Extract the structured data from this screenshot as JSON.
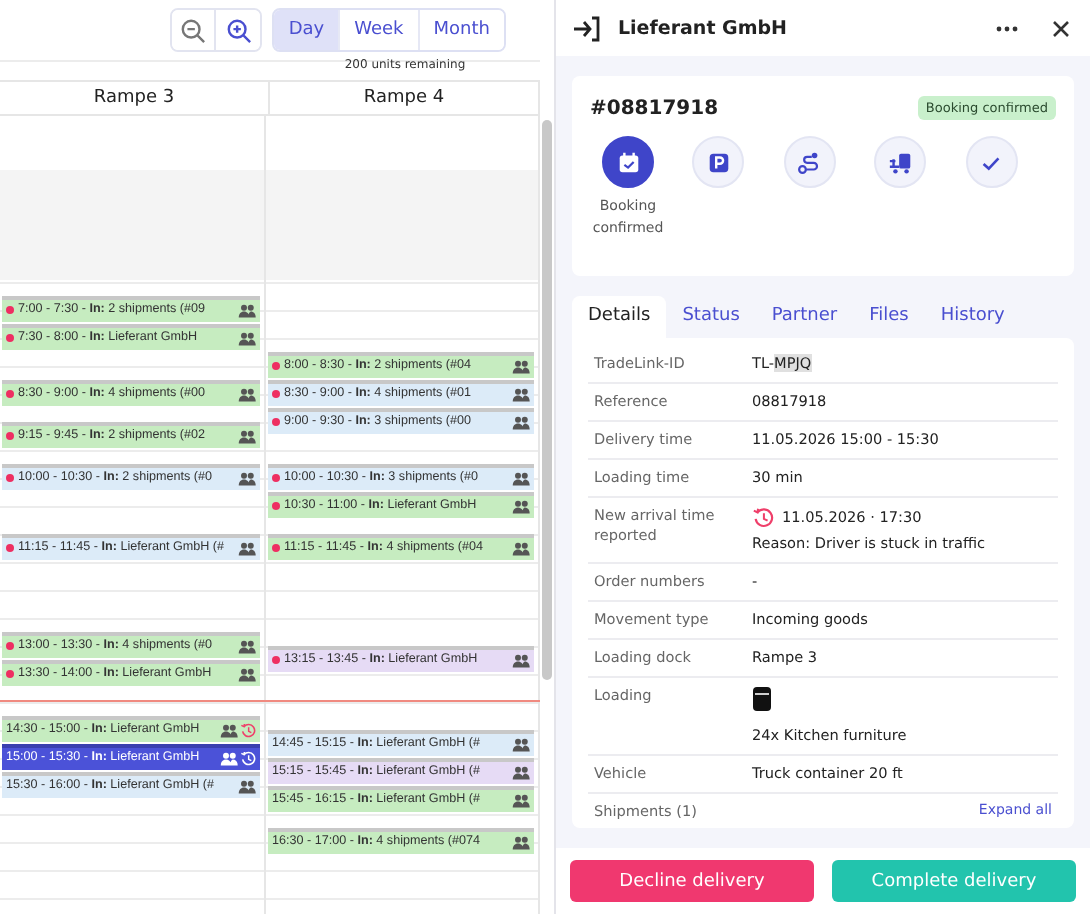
{
  "toolbar": {
    "zoom_buttons": [
      {
        "kind": "zoom-out"
      },
      {
        "kind": "zoom-in"
      }
    ],
    "views": [
      {
        "label": "Day",
        "selected": true
      },
      {
        "label": "Week",
        "selected": false
      },
      {
        "label": "Month",
        "selected": false
      }
    ]
  },
  "calendar": {
    "capacity_note": "200 units remaining",
    "columns": [
      {
        "title": "Rampe 3",
        "events": [
          {
            "time": "7:00 - 7:30",
            "text": " - **In:** 2 shipments (#09",
            "color": "#c6ecc0",
            "alert": true,
            "delayed": false,
            "selected": false
          },
          {
            "time": "7:30 - 8:00",
            "text": " - **In:** Lieferant GmbH",
            "color": "#c6ecc0",
            "alert": true,
            "delayed": false,
            "selected": false
          },
          {
            "time": "8:30 - 9:00",
            "text": " - **In:** 4 shipments (#00",
            "color": "#c6ecc0",
            "alert": true,
            "delayed": false,
            "selected": false
          },
          {
            "time": "9:15 - 9:45",
            "text": " - **In:** 2 shipments (#02",
            "color": "#c6ecc0",
            "alert": true,
            "delayed": false,
            "selected": false
          },
          {
            "time": "10:00 - 10:30",
            "text": " - **In:** 2 shipments (#0",
            "color": "#dcebf8",
            "alert": true,
            "delayed": false,
            "selected": false
          },
          {
            "time": "11:15 - 11:45",
            "text": " - **In:** Lieferant GmbH (#",
            "color": "#dcebf8",
            "alert": true,
            "delayed": false,
            "selected": false
          },
          {
            "time": "13:00 - 13:30",
            "text": " - **In:** 4 shipments (#0",
            "color": "#c6ecc0",
            "alert": true,
            "delayed": false,
            "selected": false
          },
          {
            "time": "13:30 - 14:00",
            "text": " - **In:** Lieferant GmbH",
            "color": "#c6ecc0",
            "alert": true,
            "delayed": false,
            "selected": false
          },
          {
            "time": "14:30 - 15:00",
            "text": " - **In:** Lieferant GmbH",
            "color": "#c6ecc0",
            "alert": false,
            "delayed": true,
            "selected": false
          },
          {
            "time": "15:00 - 15:30",
            "text": " - **In:** Lieferant GmbH",
            "color": "#4b52d8",
            "alert": false,
            "delayed": true,
            "selected": true
          },
          {
            "time": "15:30 - 16:00",
            "text": " - **In:** Lieferant GmbH (#",
            "color": "#dcebf8",
            "alert": false,
            "delayed": false,
            "selected": false
          }
        ]
      },
      {
        "title": "Rampe 4",
        "events": [
          {
            "time": "8:00 - 8:30",
            "text": " - **In:** 2 shipments (#04",
            "color": "#c6ecc0",
            "alert": true,
            "delayed": false,
            "selected": false
          },
          {
            "time": "8:30 - 9:00",
            "text": " - **In:** 4 shipments (#01",
            "color": "#dcebf8",
            "alert": true,
            "delayed": false,
            "selected": false
          },
          {
            "time": "9:00 - 9:30",
            "text": " - **In:** 3 shipments (#00",
            "color": "#dcebf8",
            "alert": true,
            "delayed": false,
            "selected": false
          },
          {
            "time": "10:00 - 10:30",
            "text": " - **In:** 3 shipments (#0",
            "color": "#dcebf8",
            "alert": true,
            "delayed": false,
            "selected": false
          },
          {
            "time": "10:30 - 11:00",
            "text": " - **In:** Lieferant GmbH",
            "color": "#c6ecc0",
            "alert": true,
            "delayed": false,
            "selected": false
          },
          {
            "time": "11:15 - 11:45",
            "text": " - **In:** 4 shipments (#04",
            "color": "#c6ecc0",
            "alert": true,
            "delayed": false,
            "selected": false
          },
          {
            "time": "13:15 - 13:45",
            "text": " - **In:** Lieferant GmbH",
            "color": "#e6dbf5",
            "alert": true,
            "delayed": false,
            "selected": false
          },
          {
            "time": "14:45 - 15:15",
            "text": " - **In:** Lieferant GmbH (#",
            "color": "#dcebf8",
            "alert": false,
            "delayed": false,
            "selected": false
          },
          {
            "time": "15:15 - 15:45",
            "text": " - **In:** Lieferant GmbH (#",
            "color": "#e6dbf5",
            "alert": false,
            "delayed": false,
            "selected": false
          },
          {
            "time": "15:45 - 16:15",
            "text": " - **In:** Lieferant GmbH (#",
            "color": "#c6ecc0",
            "alert": false,
            "delayed": false,
            "selected": false
          },
          {
            "time": "16:30 - 17:00",
            "text": " - **In:** 4 shipments (#074",
            "color": "#c6ecc0",
            "alert": false,
            "delayed": false,
            "selected": false
          }
        ]
      }
    ]
  },
  "panel": {
    "title": "Lieferant GmbH",
    "booking": {
      "number": "#08817918",
      "badge": "Booking confirmed",
      "steps": [
        {
          "kind": "calendar",
          "selected": true,
          "label": "Booking confirmed"
        },
        {
          "kind": "parking",
          "selected": false
        },
        {
          "kind": "route",
          "selected": false
        },
        {
          "kind": "unloading",
          "selected": false
        },
        {
          "kind": "done",
          "selected": false
        }
      ]
    },
    "tabs": [
      {
        "label": "Details",
        "selected": true
      },
      {
        "label": "Status",
        "selected": false
      },
      {
        "label": "Partner",
        "selected": false
      },
      {
        "label": "Files",
        "selected": false
      },
      {
        "label": "History",
        "selected": false
      }
    ],
    "details": [
      {
        "kind": "text",
        "label": "TradeLink-ID",
        "value": "TL-",
        "highlight": "MPJQ"
      },
      {
        "kind": "text",
        "label": "Reference",
        "value": "08817918"
      },
      {
        "kind": "text",
        "label": "Delivery time",
        "value": "11.05.2026 15:00 - 15:30"
      },
      {
        "kind": "text",
        "label": "Loading time",
        "value": "30 min"
      },
      {
        "kind": "delay",
        "label": "New arrival time reported",
        "value": "11.05.2026 · 17:30",
        "note": "Reason: Driver is stuck in traffic"
      },
      {
        "kind": "text",
        "label": "Order numbers",
        "value": "-"
      },
      {
        "kind": "text",
        "label": "Movement type",
        "value": "Incoming goods"
      },
      {
        "kind": "text",
        "label": "Loading dock",
        "value": "Rampe 3"
      },
      {
        "kind": "loading",
        "label": "Loading",
        "value": "24x Kitchen furniture"
      },
      {
        "kind": "text",
        "label": "Vehicle",
        "value": "Truck container 20 ft"
      }
    ],
    "shipments": {
      "title": "Shipments (1)",
      "link": "Expand all"
    },
    "actions": [
      {
        "kind": "decline",
        "label": "Decline delivery"
      },
      {
        "kind": "complete",
        "label": "Complete delivery"
      }
    ]
  }
}
